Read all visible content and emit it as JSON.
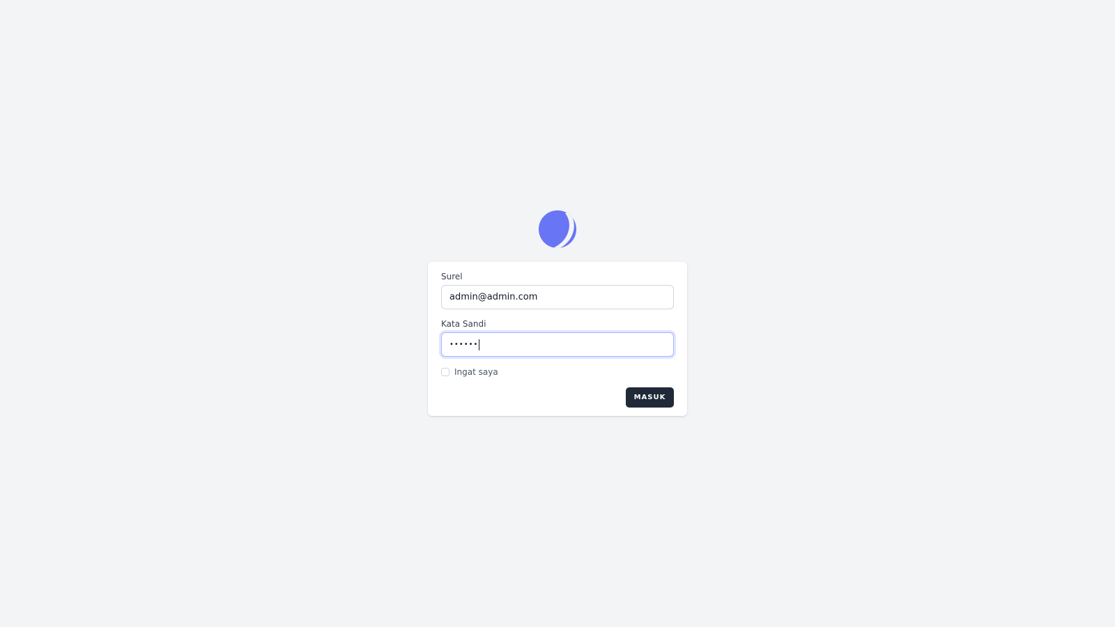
{
  "brand": {
    "logo_icon": "moon-crescent-logo-icon",
    "accent_color": "#6875f5"
  },
  "login_form": {
    "email": {
      "label": "Surel",
      "value": "admin@admin.com"
    },
    "password": {
      "label": "Kata Sandi",
      "masked_value": "••••••"
    },
    "remember": {
      "label": "Ingat saya",
      "checked": false
    },
    "submit_label": "MASUK",
    "submit_color": "#1f2937"
  }
}
